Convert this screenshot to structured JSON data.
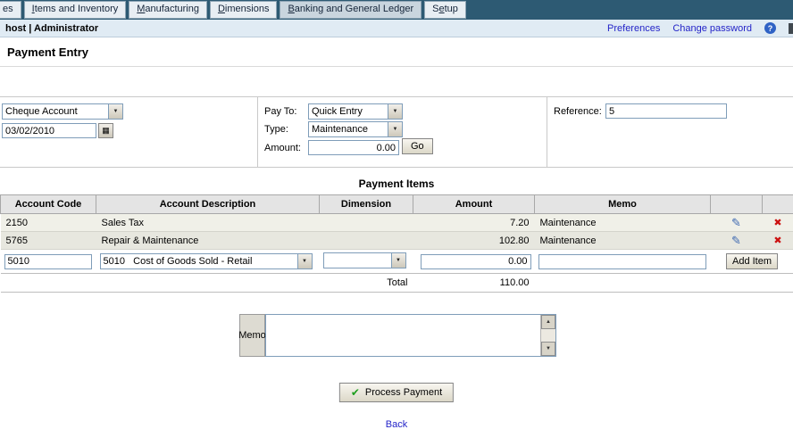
{
  "icons": {
    "dropdown": "▼",
    "edit": "✎",
    "delete": "✖",
    "check": "✔",
    "help": "?",
    "calendar": "▦",
    "scroll_up": "▲",
    "scroll_down": "▼"
  },
  "nav": {
    "tabs": [
      {
        "pre": "",
        "key": "",
        "post": "es"
      },
      {
        "pre": "",
        "key": "I",
        "post": "tems and Inventory"
      },
      {
        "pre": "",
        "key": "M",
        "post": "anufacturing"
      },
      {
        "pre": "",
        "key": "D",
        "post": "imensions"
      },
      {
        "pre": "",
        "key": "B",
        "post": "anking and General Ledger"
      },
      {
        "pre": "S",
        "key": "e",
        "post": "tup"
      }
    ]
  },
  "header": {
    "user": "host | Administrator",
    "preferences": "Preferences",
    "change_password": "Change password"
  },
  "page": {
    "title": "Payment Entry"
  },
  "form": {
    "account_value": "Cheque Account",
    "date_value": "03/02/2010",
    "pay_to_label": "Pay To:",
    "pay_to_value": "Quick Entry",
    "type_label": "Type:",
    "type_value": "Maintenance",
    "amount_label": "Amount:",
    "amount_value": "0.00",
    "go_button": "Go",
    "reference_label": "Reference:",
    "reference_value": "5"
  },
  "items": {
    "title": "Payment Items",
    "columns": [
      "Account Code",
      "Account Description",
      "Dimension",
      "Amount",
      "Memo"
    ],
    "rows": [
      {
        "code": "2150",
        "description": "Sales Tax",
        "dimension": "",
        "amount": "7.20",
        "memo": "Maintenance"
      },
      {
        "code": "5765",
        "description": "Repair & Maintenance",
        "dimension": "",
        "amount": "102.80",
        "memo": "Maintenance"
      }
    ],
    "edit_row": {
      "code_value": "5010",
      "description_value": "5010   Cost of Goods Sold - Retail",
      "dimension_value": "",
      "amount_value": "0.00",
      "memo_value": "",
      "add_button": "Add Item"
    },
    "total_label": "Total",
    "total_value": "110.00"
  },
  "memo": {
    "label": "Memo"
  },
  "actions": {
    "process": "Process Payment",
    "back": "Back"
  }
}
